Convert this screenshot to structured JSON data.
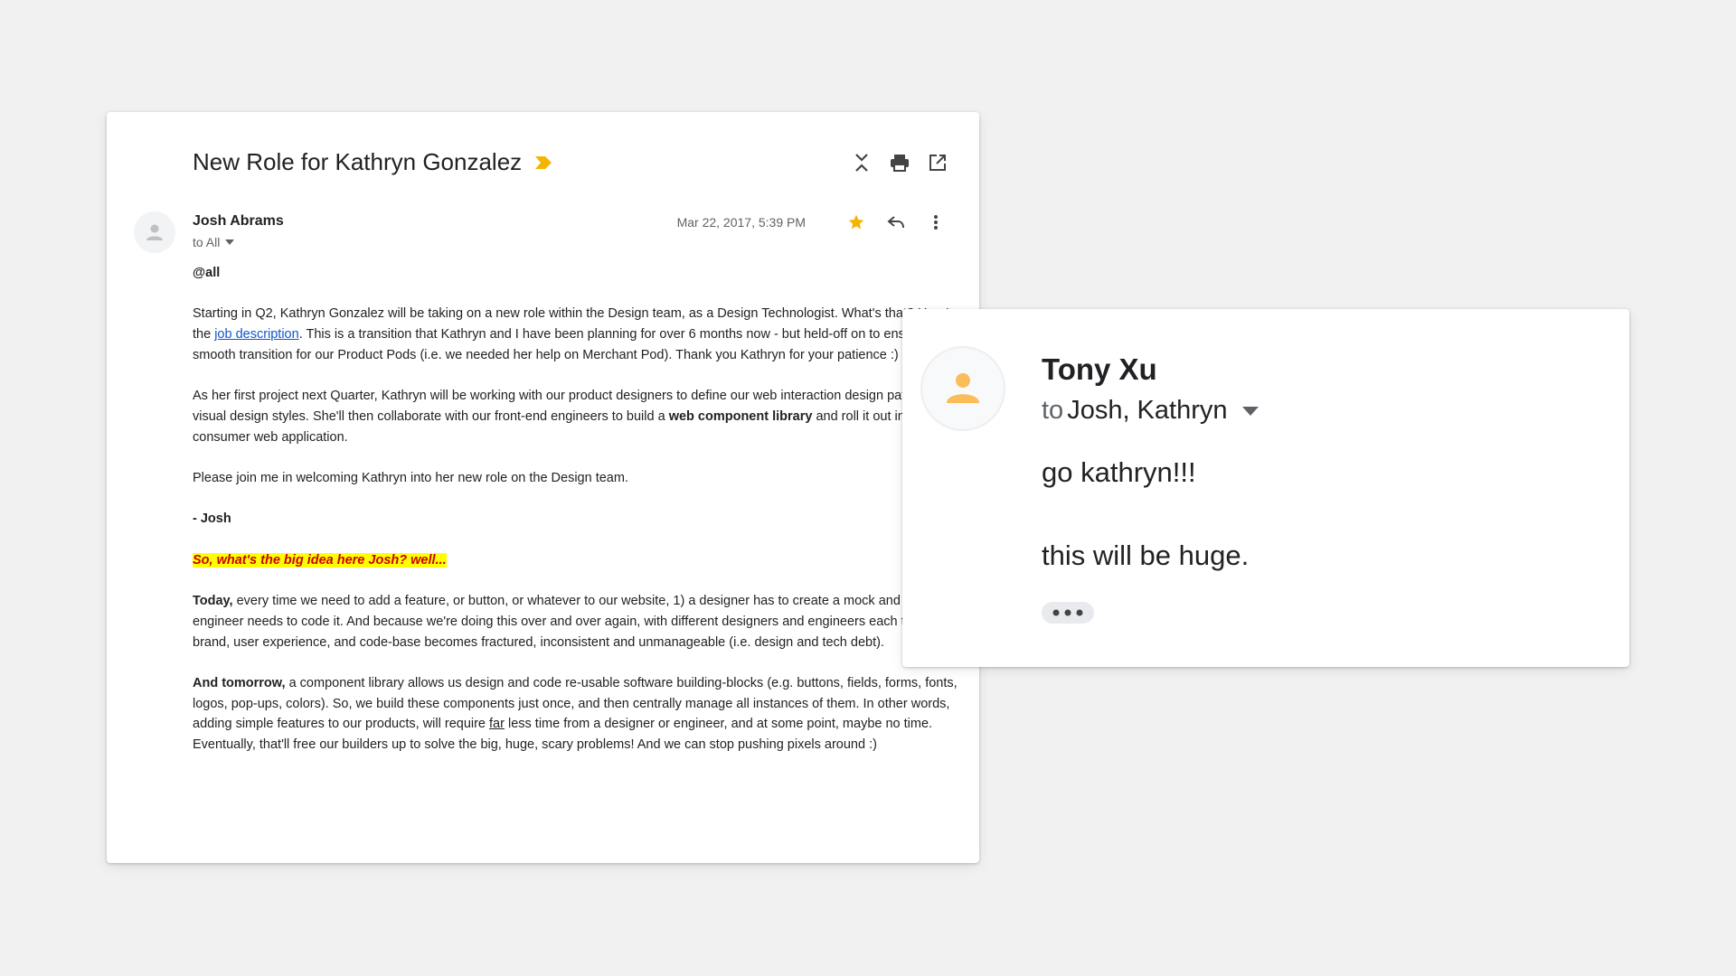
{
  "email": {
    "subject": "New Role for Kathryn Gonzalez",
    "sender": "Josh Abrams",
    "recipients": "to All",
    "date": "Mar 22, 2017, 5:39 PM",
    "greeting": "@all",
    "p1_a": "Starting in Q2, Kathryn Gonzalez will be taking on a new role within the Design team, as a Design Technologist. What's that? Here's the ",
    "p1_link": "job description",
    "p1_b": ". This is a transition that Kathryn and I have been planning for over 6 months now - but held-off on to ensure a smooth transition for our Product Pods (i.e. we needed her help on Merchant Pod). Thank you Kathryn for your patience :)",
    "p2_a": "As her first project next Quarter, Kathryn will be working with our product designers to define our web interaction design patterns and visual design styles. She'll then collaborate with our front-end engineers to build a ",
    "p2_bold": "web component library",
    "p2_b": " and roll it out into our consumer web application.",
    "p3": "Please join me in welcoming Kathryn into her new role on the Design team.",
    "signoff": "- Josh",
    "highlight": "So, what's the big idea here Josh? well...",
    "p4_bold": "Today,",
    "p4": " every time we need to add a feature, or button, or whatever to our website, 1) a designer has to create a mock and 2) an engineer needs to code it. And because we're doing this over and over again, with different designers and engineers each time; the brand, user experience, and code-base becomes fractured, inconsistent and unmanageable (i.e. design and tech debt).",
    "p5_bold": "And tomorrow,",
    "p5_a": " a component library allows us design and code re-usable software building-blocks (e.g. buttons, fields, forms, fonts, logos, pop-ups, colors). So, we build these components just once, and then centrally manage all instances of them. In other words, adding simple features to our products, will require ",
    "p5_u": "far",
    "p5_b": " less time from a designer or engineer, and at some point, maybe no time. Eventually, that'll free our builders up to solve the big, huge, scary problems! And we can stop pushing pixels around :)"
  },
  "reply": {
    "sender": "Tony Xu",
    "to_prefix": "to",
    "to_names": "Josh, Kathryn",
    "line1": "go kathryn!!!",
    "line2": "this will be huge."
  },
  "icons": {
    "importance": "importance-marker-icon",
    "collapse": "collapse-all-icon",
    "print": "print-icon",
    "new_window": "open-in-new-window-icon",
    "star": "star-icon",
    "reply": "reply-icon",
    "more": "more-vertical-icon",
    "dropdown": "dropdown-arrow-icon",
    "avatar": "avatar-icon",
    "ellipsis": "show-trimmed-content-icon"
  },
  "colors": {
    "importance": "#f4b400",
    "star": "#f4b400",
    "avatar_person": "#fbbc5a",
    "link": "#1155cc",
    "highlight_bg": "#ffff00",
    "highlight_text": "#cc0000"
  }
}
